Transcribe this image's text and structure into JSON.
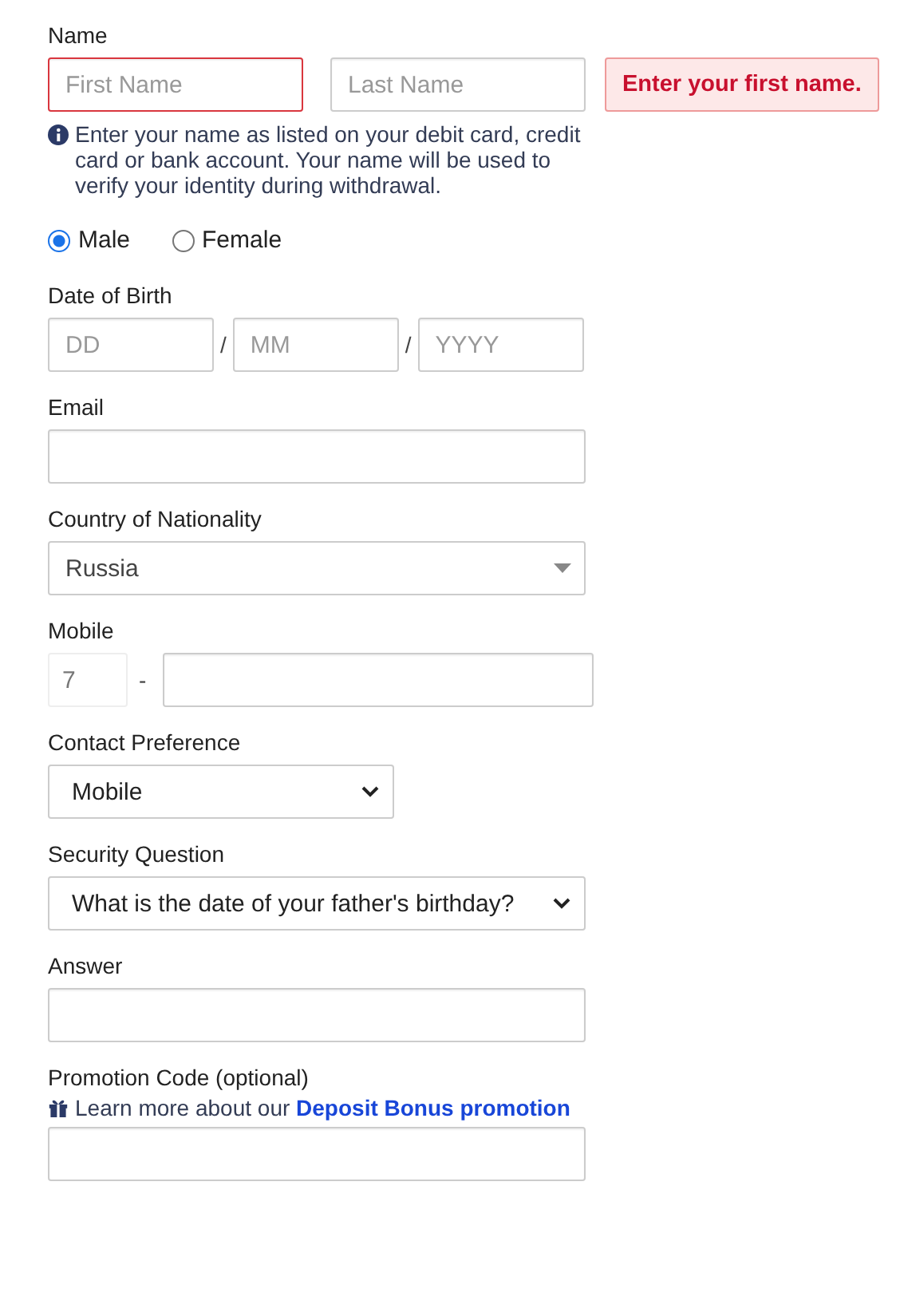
{
  "name_section": {
    "label": "Name",
    "first_name": {
      "placeholder": "First Name",
      "invalid": true
    },
    "last_name": {
      "placeholder": "Last Name",
      "invalid": false
    },
    "error": "Enter your first name.",
    "hint": "Enter your name as listed on your debit card, credit card or bank account. Your name will be used to verify your identity during withdrawal."
  },
  "gender": [
    {
      "label": "Male",
      "selected": true
    },
    {
      "label": "Female",
      "selected": false
    }
  ],
  "date_of_birth": {
    "label": "Date of Birth",
    "fields": [
      {
        "placeholder": "DD"
      },
      {
        "placeholder": "MM"
      },
      {
        "placeholder": "YYYY"
      }
    ],
    "separator": "/"
  },
  "email": {
    "label": "Email"
  },
  "country": {
    "label": "Country of Nationality",
    "value": "Russia"
  },
  "mobile": {
    "label": "Mobile",
    "prefix": "7",
    "separator": "-"
  },
  "contact_preference": {
    "label": "Contact Preference",
    "value": "Mobile"
  },
  "security_question": {
    "label": "Security Question",
    "value": "What is the date of your father's birthday?"
  },
  "answer": {
    "label": "Answer"
  },
  "promotion": {
    "label": "Promotion Code (optional)",
    "hint": "Learn more about our",
    "link": "Deposit Bonus promotion"
  }
}
